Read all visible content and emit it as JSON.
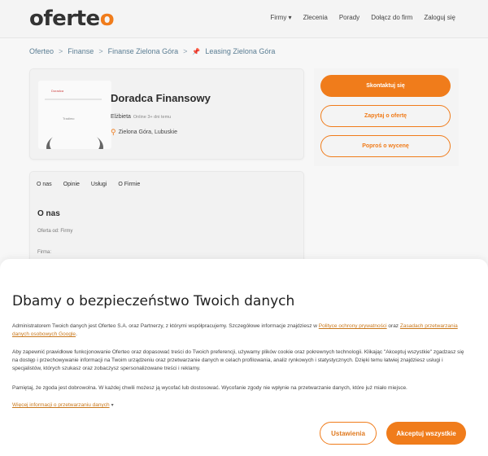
{
  "header": {
    "logo_text": "oferte",
    "logo_tail": "o",
    "nav": [
      "Firmy ▾",
      "Zlecenia",
      "Porady",
      "Dołącz do firm",
      "Zaloguj się"
    ]
  },
  "breadcrumb": {
    "items": [
      "Oferteo",
      "Finanse",
      "Finanse Zielona Góra",
      "Leasing Zielona Góra"
    ],
    "separator": ">"
  },
  "profile": {
    "thumb_text_top": "Doradca",
    "thumb_text_mid": "Tradimo",
    "name": "Doradca Finansowy",
    "person": "Elżbieta",
    "online": "Online 3+ dni temu",
    "location": "Zielona Góra, Lubuskie"
  },
  "actions": {
    "contact": "Skontaktuj się",
    "ask_offer": "Zapytaj o ofertę",
    "ask_price": "Poproś o wycenę"
  },
  "tabs": [
    "O nas",
    "Opinie",
    "Usługi",
    "O Firmie"
  ],
  "about": {
    "title": "O nas",
    "field1": "Oferta od: Firmy",
    "field2": "Firma:"
  },
  "cookie": {
    "title": "Dbamy o bezpieczeństwo Twoich danych",
    "p1_a": "Administratorem Twoich danych jest Oferteo S.A. oraz Partnerzy, z którymi współpracujemy. Szczegółowe informacje znajdziesz w ",
    "p1_link1": "Polityce ochrony prywatności",
    "p1_b": " oraz ",
    "p1_link2": "Zasadach przetwarzania danych osobowych Google",
    "p1_c": ".",
    "p2": "Aby zapewnić prawidłowe funkcjonowanie Oferteo oraz dopasować treści do Twoich preferencji, używamy plików cookie oraz pokrewnych technologii. Klikając \"Akceptuj wszystkie\" zgadzasz się na dostęp i przechowywanie informacji na Twoim urządzeniu oraz przetwarzanie danych w celach profilowania, analiz rynkowych i statystycznych. Dzięki temu łatwiej znajdziesz usługi i specjalistów, których szukasz oraz zobaczysz spersonalizowane treści i reklamy.",
    "p3": "Pamiętaj, że zgoda jest dobrowolna. W każdej chwili możesz ją wycofać lub dostosować. Wycofanie zgody nie wpłynie na przetwarzanie danych, które już miało miejsce.",
    "more": "Więcej informacji o przetwarzaniu danych",
    "settings": "Ustawienia",
    "accept": "Akceptuj wszystkie"
  },
  "colors": {
    "accent": "#f07c1b",
    "link": "#5a7d93"
  }
}
